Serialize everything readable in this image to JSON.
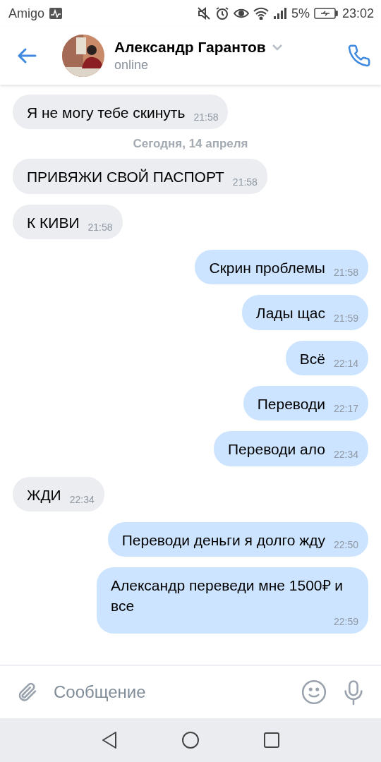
{
  "status_bar": {
    "carrier": "Amigo",
    "battery_percent": "5%",
    "time": "23:02"
  },
  "header": {
    "name": "Александр Гарантов",
    "status": "online"
  },
  "messages": [
    {
      "kind": "message",
      "outgoing": false,
      "text": "Я не могу тебе скинуть",
      "time": "21:58"
    },
    {
      "kind": "date",
      "text": "Сегодня, 14 апреля"
    },
    {
      "kind": "message",
      "outgoing": false,
      "text": "ПРИВЯЖИ СВОЙ ПАСПОРТ",
      "time": "21:58"
    },
    {
      "kind": "message",
      "outgoing": false,
      "text": "К КИВИ",
      "time": "21:58"
    },
    {
      "kind": "message",
      "outgoing": true,
      "text": "Скрин проблемы",
      "time": "21:58"
    },
    {
      "kind": "message",
      "outgoing": true,
      "text": "Лады щас",
      "time": "21:59"
    },
    {
      "kind": "message",
      "outgoing": true,
      "text": "Всё",
      "time": "22:14"
    },
    {
      "kind": "message",
      "outgoing": true,
      "text": "Переводи",
      "time": "22:17"
    },
    {
      "kind": "message",
      "outgoing": true,
      "text": "Переводи ало",
      "time": "22:34"
    },
    {
      "kind": "message",
      "outgoing": false,
      "text": "ЖДИ",
      "time": "22:34"
    },
    {
      "kind": "message",
      "outgoing": true,
      "text": "Переводи деньги я долго жду",
      "time": "22:50"
    },
    {
      "kind": "message",
      "outgoing": true,
      "text": "Александр переведи мне 1500₽ и все",
      "time": "22:59"
    }
  ],
  "composer": {
    "placeholder": "Сообщение"
  }
}
